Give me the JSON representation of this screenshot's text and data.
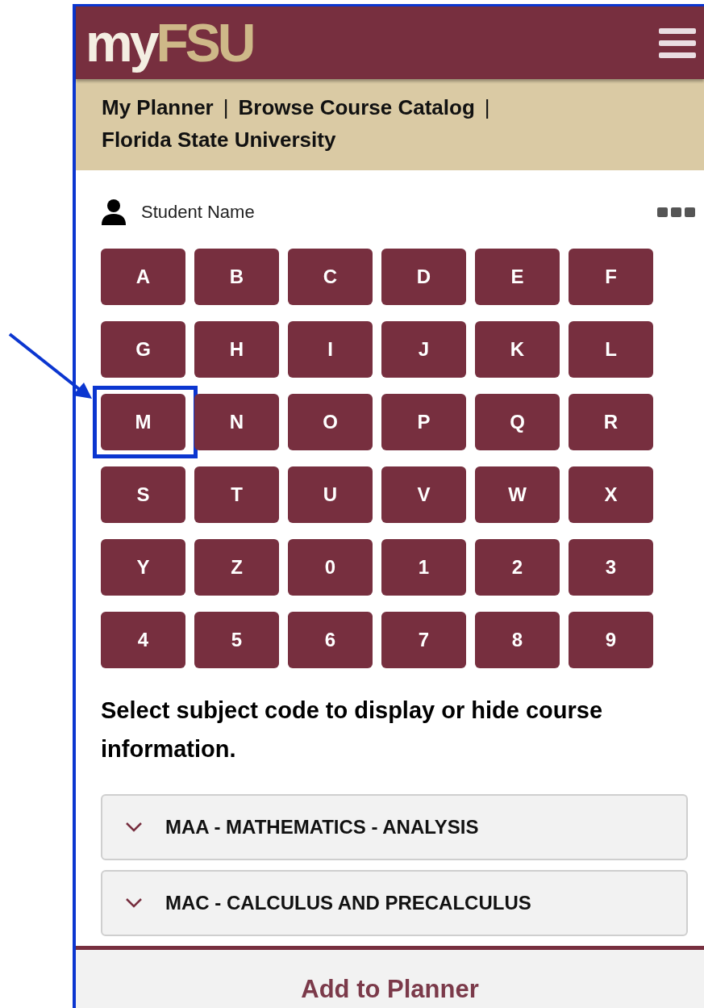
{
  "header": {
    "logo": {
      "first": "my",
      "second": "FSU"
    }
  },
  "breadcrumbs": [
    "My Planner",
    "|",
    "Browse Course Catalog",
    "|",
    "Florida State University"
  ],
  "user": {
    "name": "Student Name"
  },
  "keys": [
    {
      "label": "A",
      "highlighted": false
    },
    {
      "label": "B",
      "highlighted": false
    },
    {
      "label": "C",
      "highlighted": false
    },
    {
      "label": "D",
      "highlighted": false
    },
    {
      "label": "E",
      "highlighted": false
    },
    {
      "label": "F",
      "highlighted": false
    },
    {
      "label": "G",
      "highlighted": false
    },
    {
      "label": "H",
      "highlighted": false
    },
    {
      "label": "I",
      "highlighted": false
    },
    {
      "label": "J",
      "highlighted": false
    },
    {
      "label": "K",
      "highlighted": false
    },
    {
      "label": "L",
      "highlighted": false
    },
    {
      "label": "M",
      "highlighted": true
    },
    {
      "label": "N",
      "highlighted": false
    },
    {
      "label": "O",
      "highlighted": false
    },
    {
      "label": "P",
      "highlighted": false
    },
    {
      "label": "Q",
      "highlighted": false
    },
    {
      "label": "R",
      "highlighted": false
    },
    {
      "label": "S",
      "highlighted": false
    },
    {
      "label": "T",
      "highlighted": false
    },
    {
      "label": "U",
      "highlighted": false
    },
    {
      "label": "V",
      "highlighted": false
    },
    {
      "label": "W",
      "highlighted": false
    },
    {
      "label": "X",
      "highlighted": false
    },
    {
      "label": "Y",
      "highlighted": false
    },
    {
      "label": "Z",
      "highlighted": false
    },
    {
      "label": "0",
      "highlighted": false
    },
    {
      "label": "1",
      "highlighted": false
    },
    {
      "label": "2",
      "highlighted": false
    },
    {
      "label": "3",
      "highlighted": false
    },
    {
      "label": "4",
      "highlighted": false
    },
    {
      "label": "5",
      "highlighted": false
    },
    {
      "label": "6",
      "highlighted": false
    },
    {
      "label": "7",
      "highlighted": false
    },
    {
      "label": "8",
      "highlighted": false
    },
    {
      "label": "9",
      "highlighted": false
    }
  ],
  "instruction": "Select subject code to display or hide course information.",
  "subjects": [
    {
      "label": "MAA - MATHEMATICS - ANALYSIS",
      "expanded": false
    },
    {
      "label": "MAC - CALCULUS AND PRECALCULUS",
      "expanded": false
    }
  ],
  "footer_button": "Add to Planner"
}
